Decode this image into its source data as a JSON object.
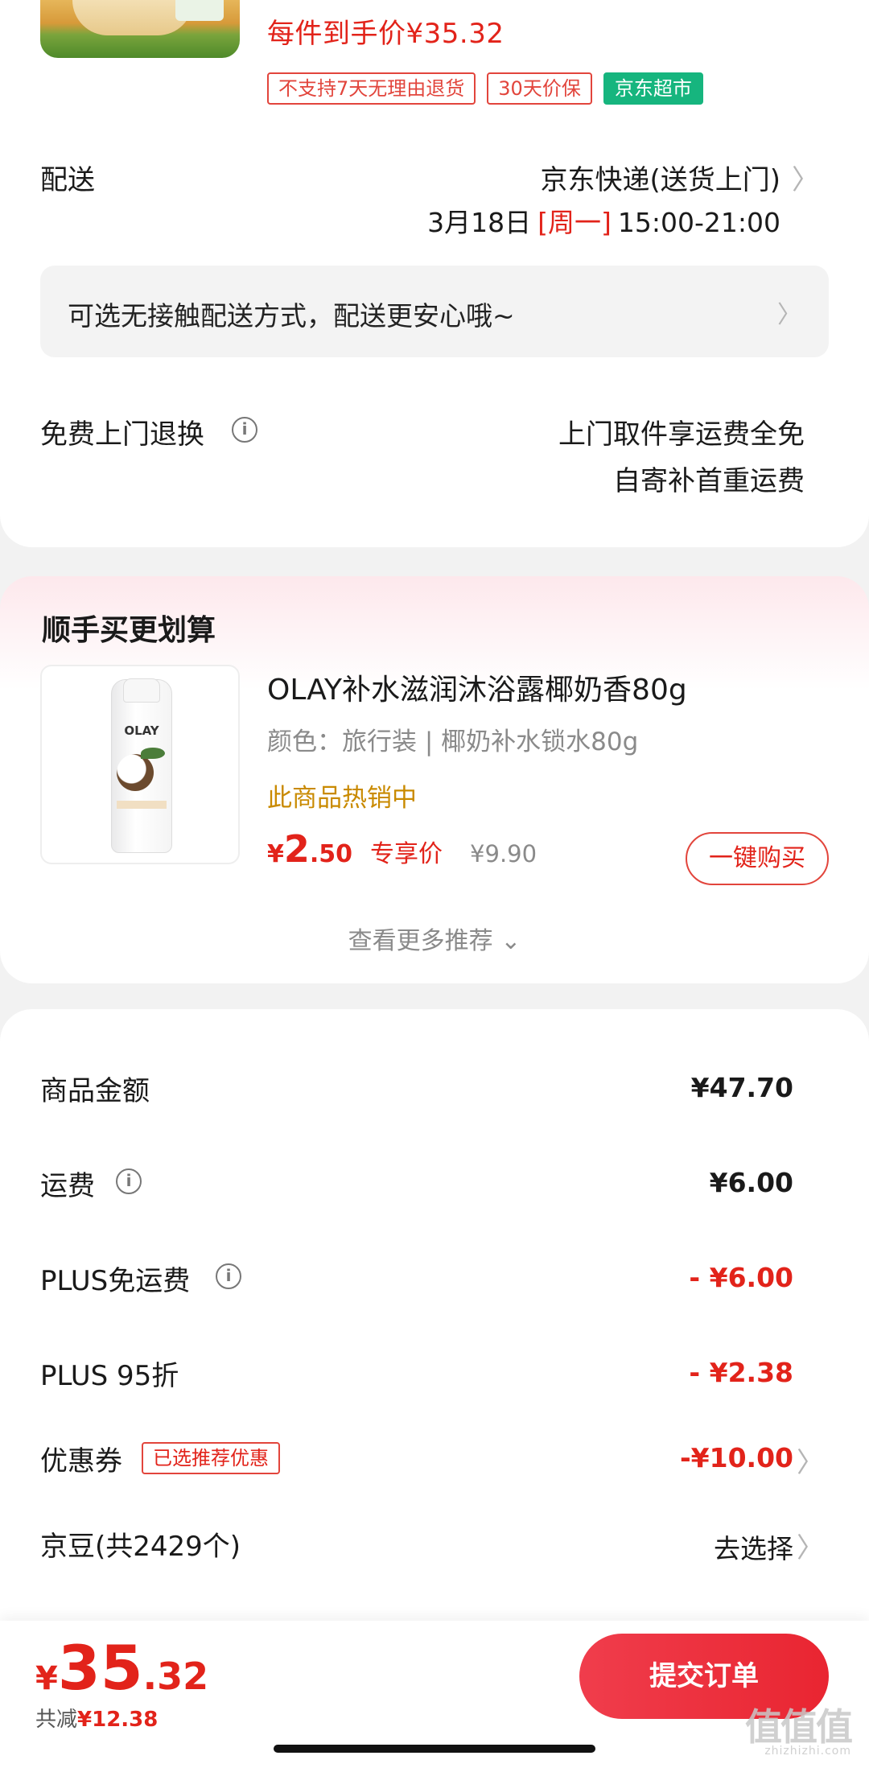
{
  "product": {
    "each_price_text": "每件到手价¥35.32",
    "tags": [
      "不支持7天无理由退货",
      "30天价保"
    ],
    "store_tag": "京东超市"
  },
  "delivery": {
    "label": "配送",
    "method": "京东快递(送货上门)",
    "date": "3月18日",
    "weekday": "[周一]",
    "time": "15:00-21:00",
    "contactless_text": "可选无接触配送方式，配送更安心哦~"
  },
  "returns": {
    "label": "免费上门退换",
    "line1": "上门取件享运费全免",
    "line2": "自寄补首重运费"
  },
  "recommend": {
    "title": "顺手买更划算",
    "product_name": "OLAY补水滋润沐浴露椰奶香80g",
    "spec": "颜色：旅行装 | 椰奶补水锁水80g",
    "hot_text": "此商品热销中",
    "price_currency": "¥",
    "price_int": "2",
    "price_dec": ".50",
    "exclusive_label": "专享价",
    "original_price": "¥9.90",
    "buy_button": "一键购买",
    "more_link": "查看更多推荐 ⌄",
    "bottle_logo": "OLAY"
  },
  "summary": {
    "rows": [
      {
        "label": "商品金额",
        "value": "¥47.70"
      },
      {
        "label": "运费",
        "value": "¥6.00"
      },
      {
        "label": "PLUS免运费",
        "value": "- ¥6.00"
      },
      {
        "label": "PLUS 95折",
        "value": "- ¥2.38"
      },
      {
        "label": "优惠券",
        "value": "-¥10.00",
        "tag": "已选推荐优惠"
      },
      {
        "label": "京豆(共2429个)",
        "value": "去选择"
      }
    ]
  },
  "bottom": {
    "currency": "¥",
    "total_int": "35",
    "total_dec": ".32",
    "saved_label": "共减",
    "saved_amount": "¥12.38",
    "submit": "提交订单"
  },
  "watermark": {
    "text": "值值值",
    "sub": "zhizhizhi.com"
  },
  "colors": {
    "accent": "#e2231a",
    "green_tag": "#16b57e",
    "gold": "#c98a00"
  }
}
